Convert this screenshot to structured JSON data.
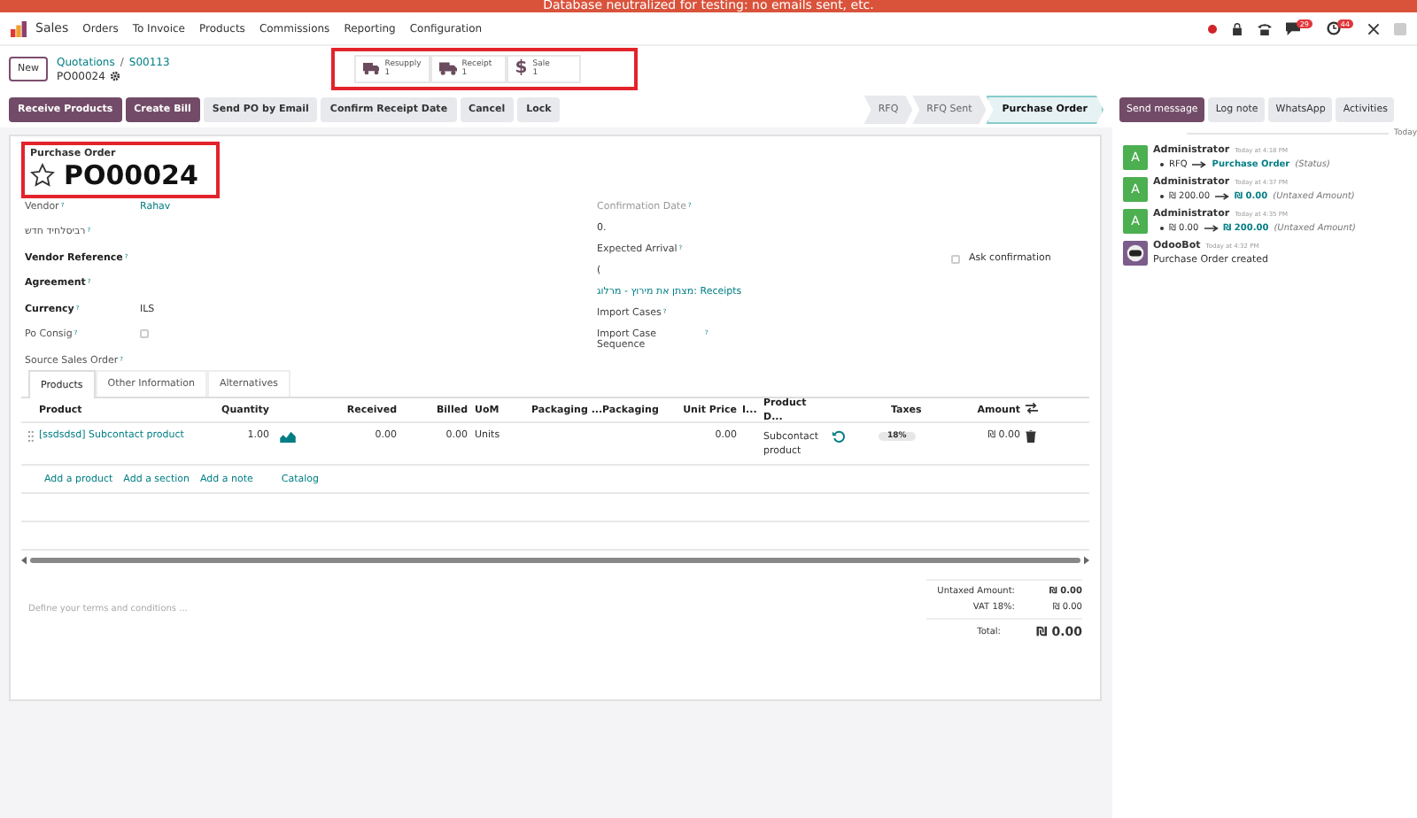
{
  "banner": {
    "text": "Database neutralized for testing: no emails sent, etc."
  },
  "navbar": {
    "app": "Sales",
    "menus": [
      "Orders",
      "To Invoice",
      "Products",
      "Commissions",
      "Reporting",
      "Configuration"
    ],
    "systray": [
      {
        "kind": "record"
      },
      {
        "kind": "lock"
      },
      {
        "kind": "phone"
      },
      {
        "kind": "chat",
        "badge": "29"
      },
      {
        "kind": "clock",
        "badge": "44"
      },
      {
        "kind": "tools"
      },
      {
        "kind": "avatar"
      }
    ]
  },
  "control_panel": {
    "new_button": "New",
    "breadcrumbs": [
      "Quotations",
      "S00113"
    ],
    "separator": "/",
    "record": "PO00024",
    "smart_buttons": [
      {
        "kind": "truck",
        "label": "Resupply",
        "count": "1"
      },
      {
        "kind": "truck",
        "label": "Receipt",
        "count": "1"
      },
      {
        "kind": "dollar",
        "symbol": "$",
        "label": "Sale",
        "count": "1"
      }
    ]
  },
  "actions": [
    {
      "label": "Receive Products",
      "primary": true
    },
    {
      "label": "Create Bill",
      "primary": true
    },
    {
      "label": "Send PO by Email",
      "primary": false
    },
    {
      "label": "Confirm Receipt Date",
      "primary": false
    },
    {
      "label": "Cancel",
      "primary": false
    },
    {
      "label": "Lock",
      "primary": false
    }
  ],
  "status_bar": [
    {
      "label": "RFQ",
      "selected": false
    },
    {
      "label": "RFQ Sent",
      "selected": false
    },
    {
      "label": "Purchase Order",
      "selected": true
    }
  ],
  "form": {
    "subtitle": "Purchase Order",
    "name": "PO00024",
    "starred": false,
    "left_fields": [
      {
        "label": "Vendor",
        "help": "?",
        "required": false,
        "kind": "link",
        "value": "Rahav"
      },
      {
        "label": "רביסלחיד חדש",
        "help": "?",
        "required": false,
        "kind": "text"
      },
      {
        "label": "Vendor Reference",
        "help": "?",
        "required": true,
        "kind": "text"
      },
      {
        "label": "Agreement",
        "help": "?",
        "required": true,
        "kind": "text"
      },
      {
        "label": "Currency",
        "help": "?",
        "required": true,
        "kind": "text",
        "value": "ILS"
      },
      {
        "label": "Po Consig",
        "help": "?",
        "required": false,
        "kind": "checkbox",
        "checked": false
      },
      {
        "label": "Source Sales Order",
        "help": "?",
        "required": false,
        "kind": "text"
      }
    ],
    "right_fields": [
      {
        "kind": "label",
        "label": "Confirmation Date",
        "help": "?",
        "muted": true
      },
      {
        "kind": "value",
        "value": "0."
      },
      {
        "kind": "label",
        "label": "Expected Arrival",
        "help": "?",
        "muted": false
      },
      {
        "kind": "value",
        "value": "("
      },
      {
        "kind": "link",
        "value": "מצתן את מירוץ - מרלוג: Receipts"
      },
      {
        "kind": "label",
        "label": "Import Cases",
        "help": "?",
        "muted": false
      },
      {
        "kind": "label",
        "label": "Import Case Sequence",
        "help": "?",
        "muted": false
      }
    ],
    "ask_confirmation": {
      "label": "Ask confirmation",
      "checked": false
    },
    "tabs": [
      {
        "label": "Products",
        "selected": true
      },
      {
        "label": "Other Information",
        "selected": false
      },
      {
        "label": "Alternatives",
        "selected": false
      }
    ],
    "table": {
      "columns": [
        "Product",
        "Quantity",
        "Received",
        "Billed",
        "UoM",
        "Packaging ...",
        "Packaging",
        "Unit Price",
        "I...",
        "Product D...",
        "Taxes",
        "Amount"
      ],
      "rows": [
        {
          "product": "[ssdsdsd] Subcontact product",
          "quantity": "1.00",
          "received": "0.00",
          "billed": "0.00",
          "uom": "Units",
          "unit_price": "0.00",
          "description": "Subcontact product",
          "tax": "18%",
          "amount": "₪ 0.00"
        }
      ],
      "add_links": [
        "Add a product",
        "Add a section",
        "Add a note",
        "Catalog"
      ]
    },
    "terms": {
      "placeholder": "Define your terms and conditions ..."
    },
    "totals": [
      {
        "label": "Untaxed Amount:",
        "value": "₪ 0.00",
        "kind": "bold"
      },
      {
        "label": "VAT 18%:",
        "value": "₪ 0.00",
        "kind": "plain"
      },
      {
        "label": "Total:",
        "value": "₪ 0.00",
        "kind": "total"
      }
    ]
  },
  "chatter": {
    "buttons": [
      {
        "label": "Send message",
        "primary": true
      },
      {
        "label": "Log note",
        "primary": false
      },
      {
        "label": "WhatsApp",
        "primary": false
      },
      {
        "label": "Activities",
        "primary": false
      }
    ],
    "date_separator": "Today",
    "messages": [
      {
        "author": "Administrator",
        "avatar": "A",
        "bot": false,
        "time": "Today at 4:18 PM",
        "kind": "tracking",
        "old": "RFQ",
        "new": "Purchase Order",
        "field": "(Status)"
      },
      {
        "author": "Administrator",
        "avatar": "A",
        "bot": false,
        "time": "Today at 4:37 PM",
        "kind": "tracking",
        "old": "₪ 200.00",
        "new": "₪ 0.00",
        "field": "(Untaxed Amount)"
      },
      {
        "author": "Administrator",
        "avatar": "A",
        "bot": false,
        "time": "Today at 4:35 PM",
        "kind": "tracking",
        "old": "₪ 0.00",
        "new": "₪ 200.00",
        "field": "(Untaxed Amount)"
      },
      {
        "author": "OdooBot",
        "bot": true,
        "time": "Today at 4:32 PM",
        "kind": "text",
        "body": "Purchase Order created"
      }
    ]
  }
}
